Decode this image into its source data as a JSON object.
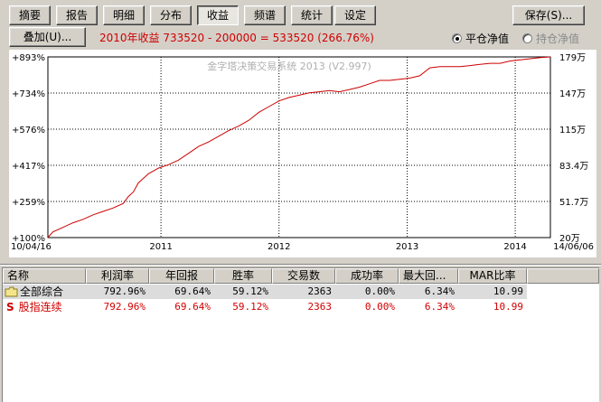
{
  "toolbar": {
    "tabs": [
      "摘要",
      "报告",
      "明细",
      "分布",
      "收益",
      "频谱",
      "统计",
      "设定"
    ],
    "active_tab": "收益",
    "save_label": "保存(S)..."
  },
  "overlay": {
    "button_label": "叠加(U)...",
    "summary": "2010年收益 733520 - 200000 = 533520 (266.76%)"
  },
  "mode": {
    "option_1": "平仓净值",
    "option_2": "持仓净值",
    "selected": "平仓净值"
  },
  "chart_data": {
    "type": "line",
    "title": "金字塔决策交易系统 2013 (V2.997)",
    "x_start_label": "10/04/16",
    "x_end_label": "14/06/06",
    "xticks": [
      "2011",
      "2012",
      "2013",
      "2014"
    ],
    "y_left_ticks": [
      "+100%",
      "+259%",
      "+417%",
      "+576%",
      "+734%",
      "+893%"
    ],
    "y_right_ticks": [
      "20万",
      "51.7万",
      "83.4万",
      "115万",
      "147万",
      "179万"
    ],
    "ylim": [
      100,
      893
    ],
    "line_color": "#cc0000",
    "series": [
      {
        "x": [
          0,
          0.01,
          0.03,
          0.05,
          0.07,
          0.09,
          0.11,
          0.13,
          0.15,
          0.16,
          0.17,
          0.18,
          0.2,
          0.22,
          0.24,
          0.26,
          0.28,
          0.3,
          0.32,
          0.34,
          0.36,
          0.38,
          0.4,
          0.42,
          0.44,
          0.46,
          0.48,
          0.5,
          0.52,
          0.54,
          0.56,
          0.58,
          0.6,
          0.62,
          0.64,
          0.66,
          0.68,
          0.7,
          0.72,
          0.74,
          0.76,
          0.78,
          0.8,
          0.82,
          0.84,
          0.86,
          0.88,
          0.9,
          0.92,
          0.94,
          0.96,
          0.98,
          1.0
        ],
        "y": [
          100,
          125,
          145,
          165,
          180,
          200,
          215,
          230,
          250,
          280,
          300,
          340,
          380,
          405,
          420,
          440,
          470,
          500,
          520,
          545,
          570,
          590,
          615,
          650,
          675,
          700,
          715,
          725,
          735,
          740,
          745,
          740,
          750,
          760,
          775,
          790,
          790,
          795,
          800,
          810,
          845,
          850,
          850,
          850,
          855,
          860,
          865,
          865,
          875,
          880,
          885,
          890,
          893
        ]
      }
    ]
  },
  "table": {
    "columns": [
      "名称",
      "利润率",
      "年回报",
      "胜率",
      "交易数",
      "成功率",
      "最大回...",
      "MAR比率"
    ],
    "rows": [
      {
        "name": "全部综合",
        "icon": "folder-icon",
        "values": [
          "792.96%",
          "69.64%",
          "59.12%",
          "2363",
          "0.00%",
          "6.34%",
          "10.99"
        ]
      },
      {
        "name": "股指连续",
        "icon": "s-marker",
        "marker": "S",
        "values": [
          "792.96%",
          "69.64%",
          "59.12%",
          "2363",
          "0.00%",
          "6.34%",
          "10.99"
        ]
      }
    ]
  }
}
